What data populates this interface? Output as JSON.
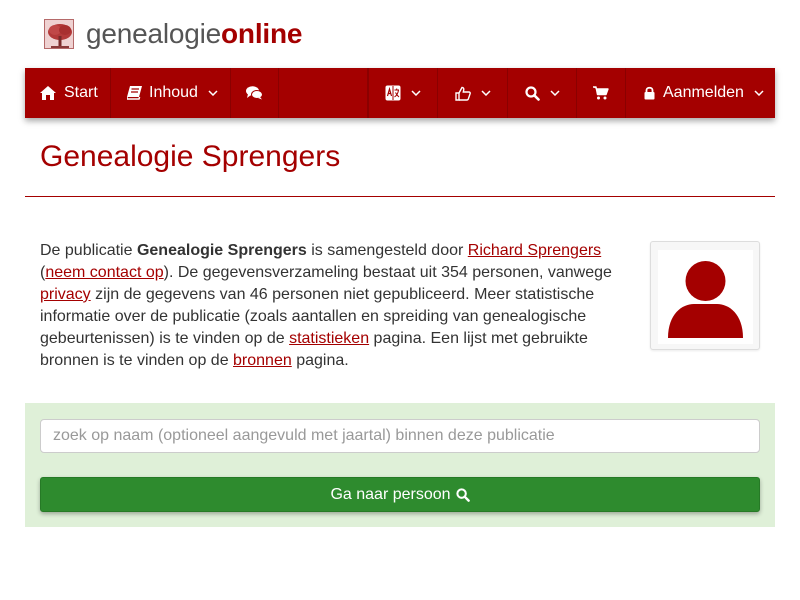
{
  "logo": {
    "text_a": "genealogie",
    "text_b": "online"
  },
  "nav": {
    "start_label": "Start",
    "inhoud_label": "Inhoud",
    "login_label": "Aanmelden"
  },
  "page": {
    "title": "Genealogie Sprengers"
  },
  "intro": {
    "t1": "De publicatie ",
    "pub_name": "Genealogie Sprengers",
    "t2": " is samengesteld door ",
    "author_link": "Richard Sprengers",
    "t3": " (",
    "contact_link": "neem contact op",
    "t4": "). De gegevensverzameling bestaat uit 354 personen, vanwege ",
    "privacy_link": "privacy",
    "t5": " zijn de gegevens van 46 personen niet gepubliceerd. Meer statistische informatie over de publicatie (zoals aantallen en spreiding van genealogische gebeurtenissen) is te vinden op de ",
    "stats_link": "statistieken",
    "t6": " pagina. Een lijst met gebruikte bronnen is te vinden op de ",
    "sources_link": "bronnen",
    "t7": " pagina."
  },
  "search": {
    "placeholder": "zoek op naam (optioneel aangevuld met jaartal) binnen deze publicatie",
    "value": "",
    "button_label": "Ga naar persoon"
  },
  "colors": {
    "brand": "#a40000",
    "search_panel": "#dff0d8",
    "button_green": "#2e8b2e"
  },
  "icons": [
    "tree-logo",
    "home-icon",
    "book-icon",
    "chevron-down-icon",
    "comments-icon",
    "translate-icon",
    "thumbs-up-icon",
    "search-icon",
    "shopping-cart-icon",
    "lock-icon",
    "user-avatar-icon"
  ]
}
